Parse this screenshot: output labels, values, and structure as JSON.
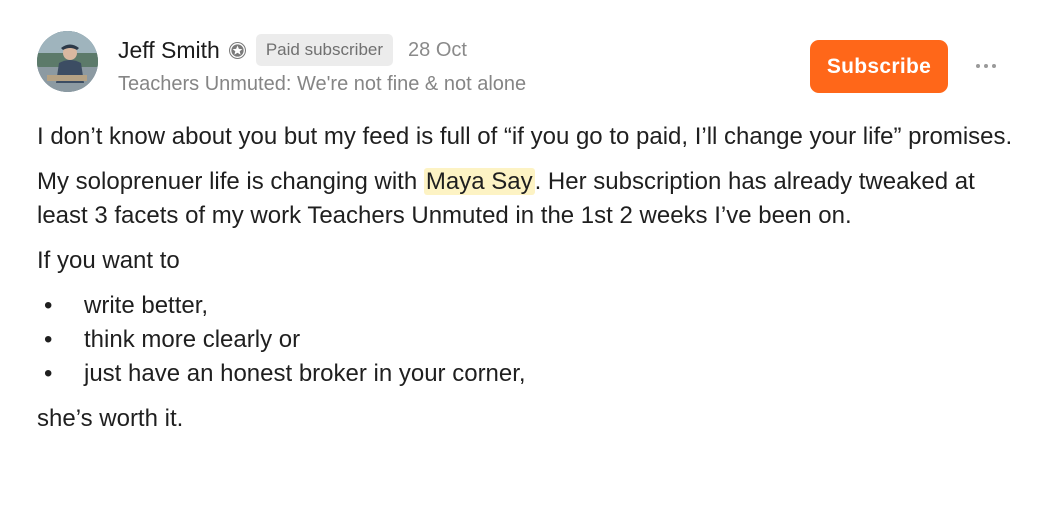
{
  "post": {
    "author": "Jeff Smith",
    "badge": "Paid subscriber",
    "date": "28 Oct",
    "publication": "Teachers Unmuted: We're not fine & not alone",
    "subscribe_label": "Subscribe",
    "more_label": "···",
    "accent_color": "#ff6719",
    "highlight_color": "#fdf3c4"
  },
  "content": {
    "p1": "I don’t know about you but my feed is full of “if you go to paid, I’ll change your life” promises.",
    "p2_before": "My soloprenuer life is changing with ",
    "p2_mention": "Maya Say",
    "p2_after": ". Her subscription has already tweaked at least 3 facets of my work Teachers Unmuted in the 1st 2 weeks I’ve been on.",
    "p3": "If you want to",
    "bullets": [
      "write better,",
      "think more clearly or",
      "just have an honest broker in your corner,"
    ],
    "p4": "she’s worth it."
  }
}
